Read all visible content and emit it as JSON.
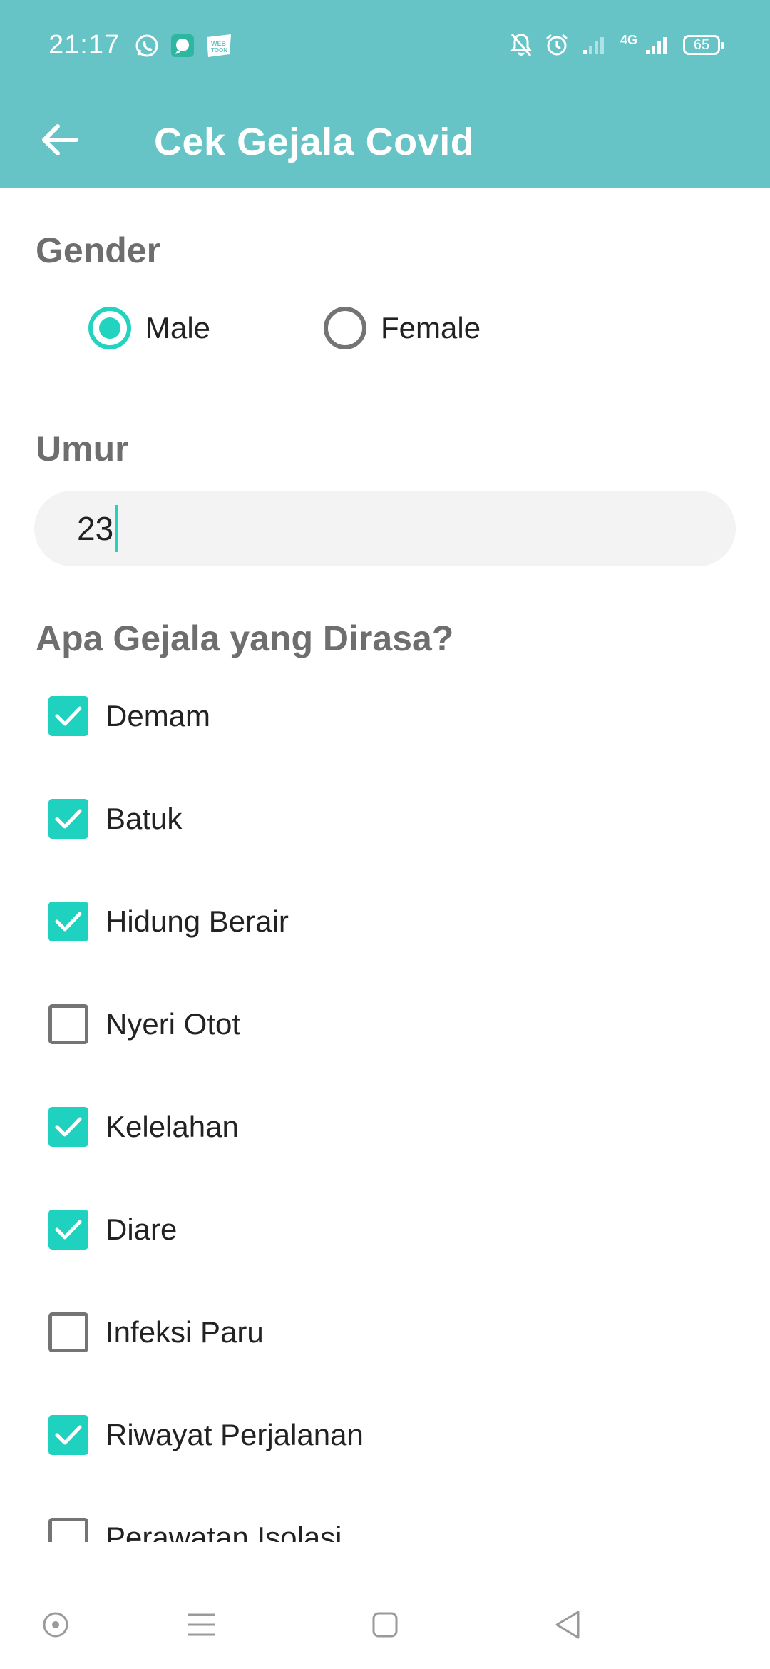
{
  "status_bar": {
    "time": "21:17",
    "app_icons": [
      "whatsapp-icon",
      "chat-bubble-icon",
      "webtoon-icon"
    ],
    "network_label": "4G",
    "battery_level": "65"
  },
  "app_bar": {
    "title": "Cek Gejala Covid",
    "back_icon": "arrow-left-icon"
  },
  "gender": {
    "title": "Gender",
    "options": [
      {
        "label": "Male",
        "selected": true
      },
      {
        "label": "Female",
        "selected": false
      }
    ]
  },
  "age": {
    "title": "Umur",
    "value": "23"
  },
  "symptoms": {
    "title": "Apa Gejala yang Dirasa?",
    "items": [
      {
        "label": "Demam",
        "checked": true
      },
      {
        "label": "Batuk",
        "checked": true
      },
      {
        "label": "Hidung Berair",
        "checked": true
      },
      {
        "label": "Nyeri Otot",
        "checked": false
      },
      {
        "label": "Kelelahan",
        "checked": true
      },
      {
        "label": "Diare",
        "checked": true
      },
      {
        "label": "Infeksi Paru",
        "checked": false
      },
      {
        "label": "Riwayat Perjalanan",
        "checked": true
      },
      {
        "label": "Perawatan Isolasi",
        "checked": false
      }
    ]
  },
  "colors": {
    "header": "#66c3c6",
    "accent": "#22d3c0",
    "section_title": "#6e6e6e"
  },
  "nav_bar": [
    "recent-apps-dot-icon",
    "menu-icon",
    "home-square-icon",
    "back-triangle-icon"
  ]
}
